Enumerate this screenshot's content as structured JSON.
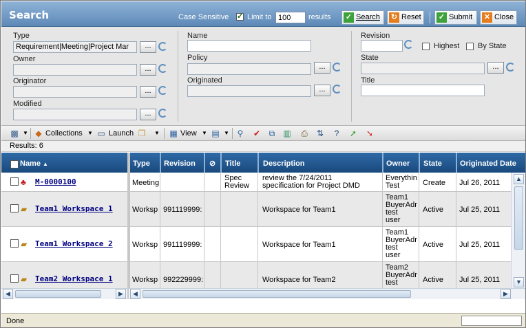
{
  "header": {
    "title": "Search",
    "case_sensitive": "Case Sensitive",
    "limit_label": "Limit to",
    "limit_value": "100",
    "results_label": "results",
    "search_label": "Search",
    "reset_label": "Reset",
    "submit_label": "Submit",
    "close_label": "Close"
  },
  "criteria": {
    "type_label": "Type",
    "type_value": "Requirement|Meeting|Project Mar",
    "owner_label": "Owner",
    "originator_label": "Originator",
    "modified_label": "Modified",
    "name_label": "Name",
    "policy_label": "Policy",
    "originated_label": "Originated",
    "revision_label": "Revision",
    "highest_label": "Highest",
    "by_state_label": "By State",
    "state_label": "State",
    "title_label": "Title",
    "dots": "..."
  },
  "toolbar": {
    "collections": "Collections",
    "launch": "Launch",
    "view": "View"
  },
  "results_text": "Results: 6",
  "table": {
    "headers": {
      "name": "Name",
      "type": "Type",
      "revision": "Revision",
      "title": "Title",
      "description": "Description",
      "owner": "Owner",
      "state": "State",
      "originated": "Originated Date"
    },
    "rows": [
      {
        "name": "M-0000100",
        "type": "Meeting",
        "revision": "",
        "title": "Spec\nReview",
        "description": "review the 7/24/2011\nspecification for Project DMD",
        "owner": "Everythin\nTest",
        "state": "Create",
        "originated": "Jul 26, 2011"
      },
      {
        "name": "Team1 Workspace 1",
        "type": "Worksp",
        "revision": "991119999:",
        "title": "",
        "description": "Workspace for Team1",
        "owner": "Team1\nBuyerAdr\ntest\nuser",
        "state": "Active",
        "originated": "Jul 25, 2011"
      },
      {
        "name": "Team1 Workspace 2",
        "type": "Worksp",
        "revision": "991119999:",
        "title": "",
        "description": "Workspace for Team1",
        "owner": "Team1\nBuyerAdr\ntest\nuser",
        "state": "Active",
        "originated": "Jul 25, 2011"
      },
      {
        "name": "Team2 Workspace 1",
        "type": "Worksp",
        "revision": "992229999:",
        "title": "",
        "description": "Workspace for Team2",
        "owner": "Team2\nBuyerAdr\ntest",
        "state": "Active",
        "originated": "Jul 25, 2011"
      }
    ]
  },
  "status": {
    "text": "Done"
  },
  "colors": {
    "header_bg": "#5d89b8",
    "grid_header": "#1f5186",
    "accent_green": "#3ea23a",
    "accent_orange": "#e67c1b"
  }
}
